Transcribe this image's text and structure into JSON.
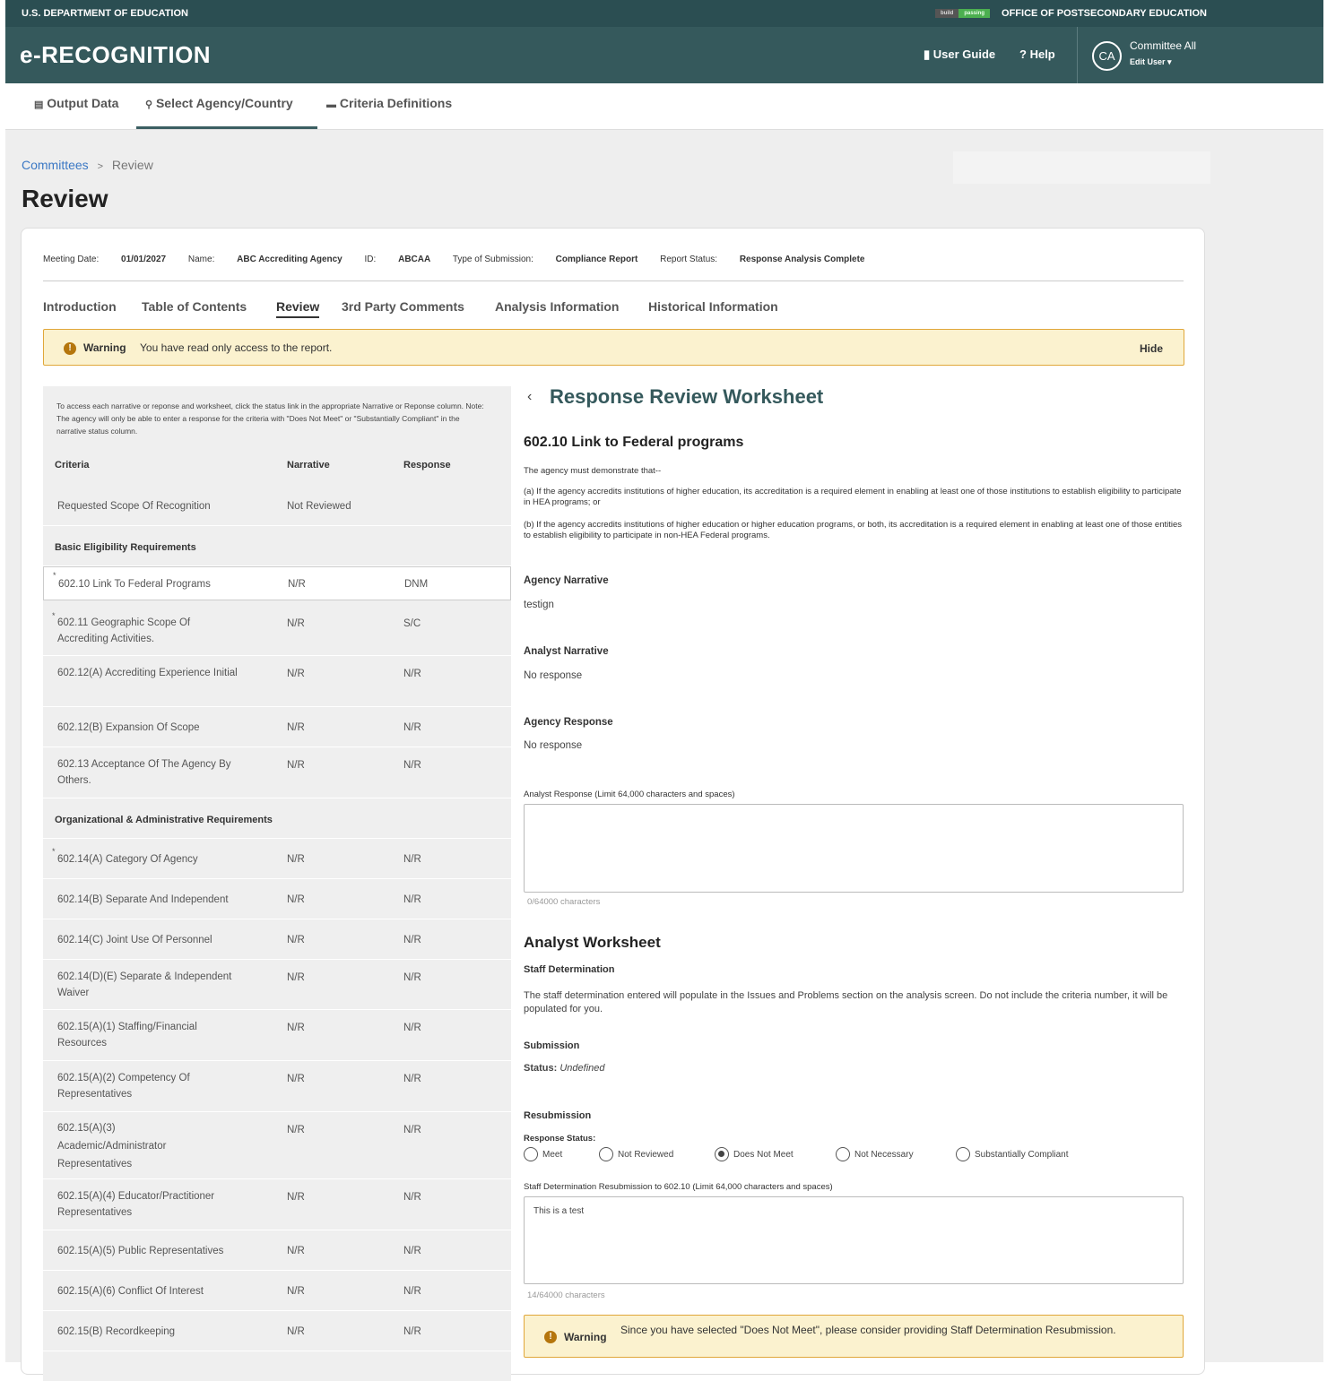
{
  "topbar": {
    "left_text": "U.S. DEPARTMENT OF EDUCATION",
    "right_text": "OFFICE OF POSTSECONDARY EDUCATION",
    "build_badge": "build",
    "status_badge": "passing"
  },
  "header": {
    "logo": "e-RECOGNITION",
    "user_guide": "User Guide",
    "help": "Help",
    "avatar_initials": "CA",
    "user_name": "Committee All",
    "edit_user": "Edit User"
  },
  "subnav": {
    "items": [
      "Output Data",
      "Select Agency/Country",
      "Criteria Definitions"
    ],
    "active": "Select Agency/Country"
  },
  "breadcrumb": {
    "parent": "Committees",
    "separator": ">",
    "current": "Review"
  },
  "page_title": "Review",
  "meta": {
    "meeting_date_label": "Meeting Date:",
    "meeting_date": "01/01/2027",
    "name_label": "Name:",
    "name": "ABC Accrediting Agency",
    "id_label": "ID:",
    "id": "ABCAA",
    "type_label": "Type of Submission:",
    "type": "Compliance Report",
    "status_label": "Report Status:",
    "status": "Response Analysis Complete"
  },
  "tabs": [
    "Introduction",
    "Table of Contents",
    "Review",
    "3rd Party Comments",
    "Analysis Information",
    "Historical Information"
  ],
  "active_tab": "Review",
  "warning": {
    "title": "Warning",
    "message": "You have read only access to the report.",
    "hide": "Hide"
  },
  "left": {
    "instructions": "To access each narrative or reponse and worksheet, click the status link in the appropriate Narrative or Reponse column. Note: The agency will only be able to enter a response for the criteria with \"Does Not Meet\" or \"Substantially Compliant\" in the narrative status column.",
    "columns": {
      "criteria": "Criteria",
      "narrative": "Narrative",
      "response": "Response"
    },
    "rows": [
      {
        "criteria": "Requested Scope Of Recognition",
        "narrative": "Not Reviewed",
        "response": ""
      },
      {
        "section": "Basic Eligibility Requirements"
      },
      {
        "criteria": "602.10 Link To Federal Programs",
        "narrative": "N/R",
        "response": "DNM",
        "asterisk": "*"
      },
      {
        "criteria": "602.11 Geographic Scope Of Accrediting Activities.",
        "narrative": "N/R",
        "response": "S/C",
        "asterisk": "*"
      },
      {
        "criteria": "602.12(A) Accrediting Experience Initial",
        "narrative": "N/R",
        "response": "N/R"
      },
      {
        "criteria": "602.12(B) Expansion Of Scope",
        "narrative": "N/R",
        "response": "N/R"
      },
      {
        "criteria": "602.13 Acceptance Of The Agency By Others.",
        "narrative": "N/R",
        "response": "N/R"
      },
      {
        "section": "Organizational & Administrative Requirements"
      },
      {
        "criteria": "602.14(A) Category Of Agency",
        "narrative": "N/R",
        "response": "N/R",
        "asterisk": "*"
      },
      {
        "criteria": "602.14(B) Separate And Independent",
        "narrative": "N/R",
        "response": "N/R"
      },
      {
        "criteria": "602.14(C) Joint Use Of Personnel",
        "narrative": "N/R",
        "response": "N/R"
      },
      {
        "criteria": "602.14(D)(E) Separate & Independent Waiver",
        "narrative": "N/R",
        "response": "N/R"
      },
      {
        "criteria": "602.15(A)(1) Staffing/Financial Resources",
        "narrative": "N/R",
        "response": "N/R"
      },
      {
        "criteria": "602.15(A)(2) Competency Of Representatives",
        "narrative": "N/R",
        "response": "N/R"
      },
      {
        "criteria": "602.15(A)(3) Academic/Administrator Representatives",
        "narrative": "N/R",
        "response": "N/R"
      },
      {
        "criteria": "602.15(A)(4) Educator/Practitioner Representatives",
        "narrative": "N/R",
        "response": "N/R"
      },
      {
        "criteria": "602.15(A)(5) Public Representatives",
        "narrative": "N/R",
        "response": "N/R"
      },
      {
        "criteria": "602.15(A)(6) Conflict Of Interest",
        "narrative": "N/R",
        "response": "N/R"
      },
      {
        "criteria": "602.15(B) Recordkeeping",
        "narrative": "N/R",
        "response": "N/R"
      }
    ]
  },
  "right": {
    "title": "Response Review Worksheet",
    "criterion_title": "602.10 Link to Federal programs",
    "intro": "The agency must demonstrate that--",
    "para_a": "(a) If the agency accredits institutions of higher education, its accreditation is a required element in enabling at least one of those institutions to establish eligibility to participate in HEA programs; or",
    "para_b": "(b) If the agency accredits institutions of higher education or higher education programs, or both, its accreditation is a required element in enabling at least one of those entities to establish eligibility to participate in non-HEA Federal programs.",
    "agency_narrative_label": "Agency Narrative",
    "agency_narrative": "testign",
    "analyst_narrative_label": "Analyst Narrative",
    "analyst_narrative": "No response",
    "agency_response_label": "Agency Response",
    "agency_response": "No response",
    "analyst_response_label": "Analyst Response (Limit 64,000 characters and spaces)",
    "analyst_response_value": "",
    "analyst_response_count": "0/64000 characters",
    "worksheet_title": "Analyst Worksheet",
    "staff_det_label": "Staff Determination",
    "staff_det_text": "The staff determination entered will populate in the Issues and Problems section on the analysis screen. Do not include the criteria number, it will be populated for you.",
    "submission_label": "Submission",
    "status_label": "Status:",
    "status_value": "Undefined",
    "resubmission_label": "Resubmission",
    "response_status_label": "Response Status:",
    "radio_options": [
      "Meet",
      "Not Reviewed",
      "Does Not Meet",
      "Not Necessary",
      "Substantially Compliant"
    ],
    "radio_selected": "Does Not Meet",
    "resub_label": "Staff Determination Resubmission to 602.10 (Limit 64,000 characters and spaces)",
    "resub_value": "This is a test",
    "resub_count": "14/64000 characters",
    "warning_title": "Warning",
    "warning_message": "Since you have selected \"Does Not Meet\", please consider providing Staff Determination Resubmission."
  },
  "colors": {
    "header": "#35595c",
    "topbar": "#2b4e52",
    "warning_bg": "#fbf2cf",
    "warning_border": "#e0a73a",
    "link": "#3b78c4"
  }
}
